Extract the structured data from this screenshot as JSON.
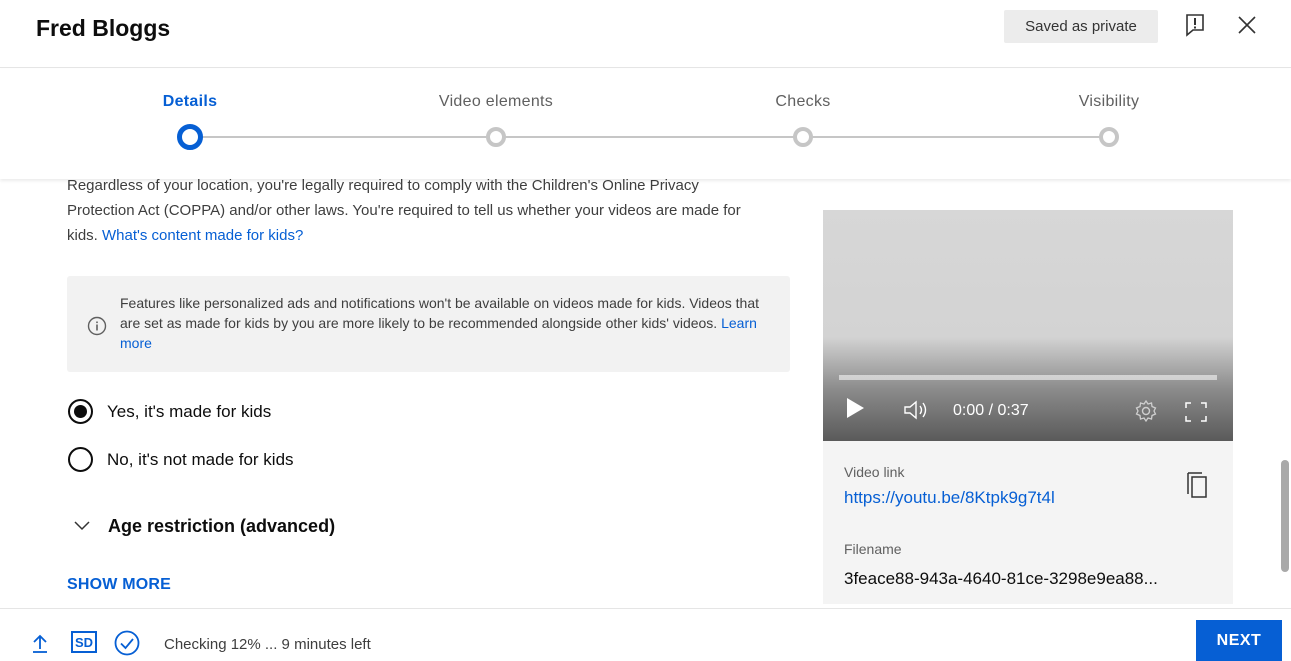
{
  "header": {
    "title": "Fred Bloggs",
    "saved_badge": "Saved as private",
    "feedback_icon": "feedback-icon",
    "close_icon": "close-icon"
  },
  "stepper": {
    "steps": [
      {
        "label": "Details",
        "active": true
      },
      {
        "label": "Video elements",
        "active": false
      },
      {
        "label": "Checks",
        "active": false
      },
      {
        "label": "Visibility",
        "active": false
      }
    ]
  },
  "audience": {
    "intro_text": "Regardless of your location, you're legally required to comply with the Children's Online Privacy Protection Act (COPPA) and/or other laws. You're required to tell us whether your videos are made for kids.",
    "intro_link": "What's content made for kids?",
    "info_text": "Features like personalized ads and notifications won't be available on videos made for kids. Videos that are set as made for kids by you are more likely to be recommended alongside other kids' videos.",
    "info_link": "Learn more",
    "options": [
      {
        "label": "Yes, it's made for kids",
        "checked": true
      },
      {
        "label": "No, it's not made for kids",
        "checked": false
      }
    ]
  },
  "age_restriction": {
    "label": "Age restriction (advanced)"
  },
  "show_more": "SHOW MORE",
  "video": {
    "time": "0:00 / 0:37",
    "link_label": "Video link",
    "link": "https://youtu.be/8Ktpk9g7t4l",
    "filename_label": "Filename",
    "filename": "3feace88-943a-4640-81ce-3298e9ea88..."
  },
  "footer": {
    "quality_badge": "SD",
    "status": "Checking 12% ... 9 minutes left",
    "next_label": "NEXT"
  },
  "colors": {
    "accent": "#065fd4",
    "badge_bg": "#ececec",
    "info_bg": "#f2f2f2"
  }
}
